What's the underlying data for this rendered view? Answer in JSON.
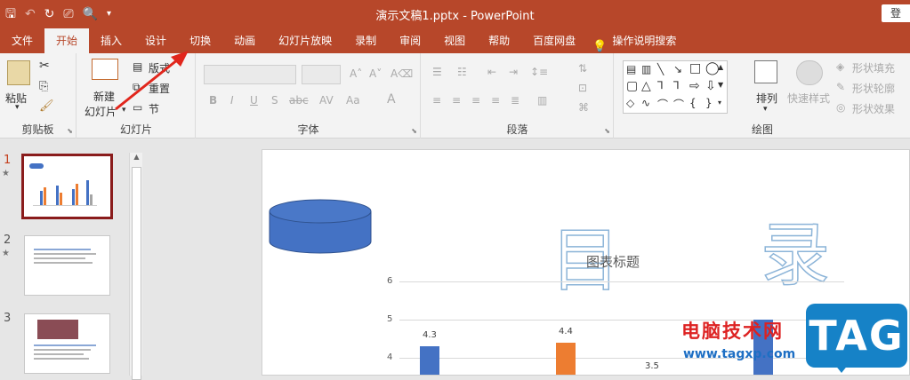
{
  "titlebar": {
    "title": "演示文稿1.pptx  -  PowerPoint",
    "login": "登",
    "qat": [
      "save-icon",
      "undo-icon",
      "redo-icon",
      "slideshow-icon",
      "print-preview-icon",
      "customize-icon"
    ]
  },
  "tabs": [
    {
      "label": "文件"
    },
    {
      "label": "开始"
    },
    {
      "label": "插入"
    },
    {
      "label": "设计"
    },
    {
      "label": "切换"
    },
    {
      "label": "动画"
    },
    {
      "label": "幻灯片放映"
    },
    {
      "label": "录制"
    },
    {
      "label": "审阅"
    },
    {
      "label": "视图"
    },
    {
      "label": "帮助"
    },
    {
      "label": "百度网盘"
    }
  ],
  "active_tab": "开始",
  "tell_me": "操作说明搜索",
  "ribbon": {
    "clipboard": {
      "label": "剪贴板",
      "paste": "粘贴"
    },
    "slides": {
      "label": "幻灯片",
      "new_slide_1": "新建",
      "new_slide_2": "幻灯片",
      "layout": "版式",
      "reset": "重置",
      "section": "节"
    },
    "font": {
      "label": "字体"
    },
    "paragraph": {
      "label": "段落"
    },
    "drawing": {
      "label": "绘图",
      "arrange": "排列",
      "quick_styles": "快速样式",
      "fill": "形状填充",
      "outline": "形状轮廓",
      "effects": "形状效果"
    }
  },
  "thumbnails": [
    {
      "num": "1",
      "star": "★"
    },
    {
      "num": "2",
      "star": "★"
    },
    {
      "num": "3",
      "star": ""
    }
  ],
  "slide": {
    "chart_title": "图表标题",
    "char_mu": "目",
    "char_lu": "录"
  },
  "chart_data": {
    "type": "bar",
    "title": "图表标题",
    "yticks": [
      "6",
      "5",
      "4"
    ],
    "data_labels": [
      "4.3",
      "4.4",
      "3.5",
      "5"
    ],
    "values": [
      4.3,
      4.4,
      3.5,
      5
    ],
    "colors": [
      "#4472c4",
      "#ed7d31",
      "#a5a5a5",
      "#4472c4"
    ]
  },
  "watermark": {
    "line1": "电脑技术网",
    "line2": "www.tagxp.com",
    "badge": "TAG"
  }
}
